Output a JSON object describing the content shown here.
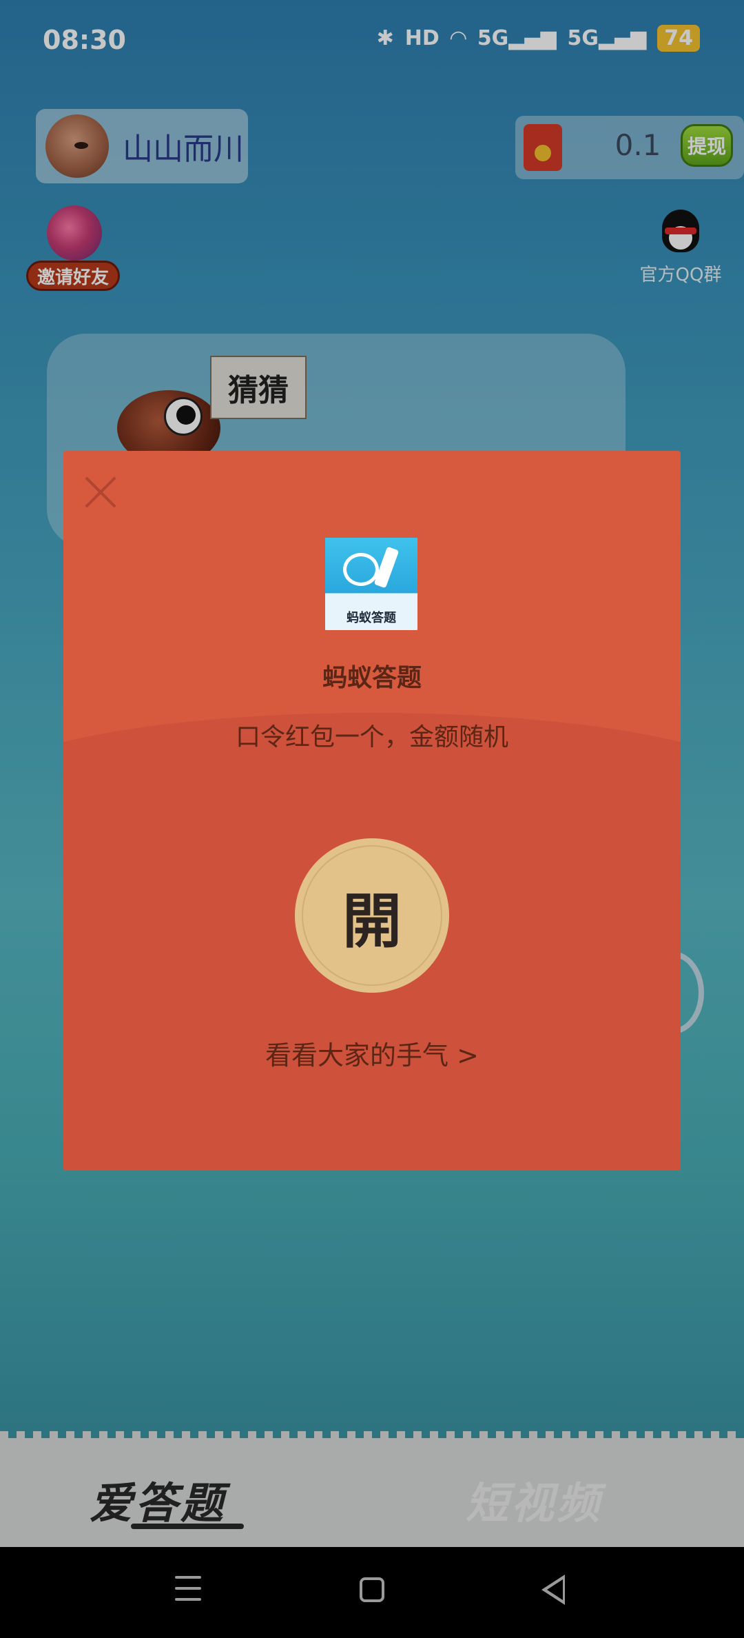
{
  "status_bar": {
    "time": "08:30",
    "icons": [
      "bluetooth-icon",
      "hd-icon",
      "wifi-icon",
      "5g-signal-icon",
      "5g-signal-icon"
    ],
    "battery": "74"
  },
  "header": {
    "user_name": "山山而川",
    "balance": "0.1",
    "withdraw_label": "提现",
    "invite_label": "邀请好友",
    "qq_label": "官方QQ群"
  },
  "game": {
    "sign_text": "猜猜"
  },
  "dialog": {
    "app_icon_label": "蚂蚁答题",
    "app_name": "蚂蚁答题",
    "promo": "口令红包一个，金额随机",
    "open_label": "開",
    "luck_link": "看看大家的手气 >"
  },
  "tabs": {
    "answer": "爱答题",
    "video": "短视频"
  },
  "colors": {
    "dialog_bg": "#d75a3f",
    "open_button": "#e3c28a",
    "withdraw_button": "#7cc22c"
  }
}
